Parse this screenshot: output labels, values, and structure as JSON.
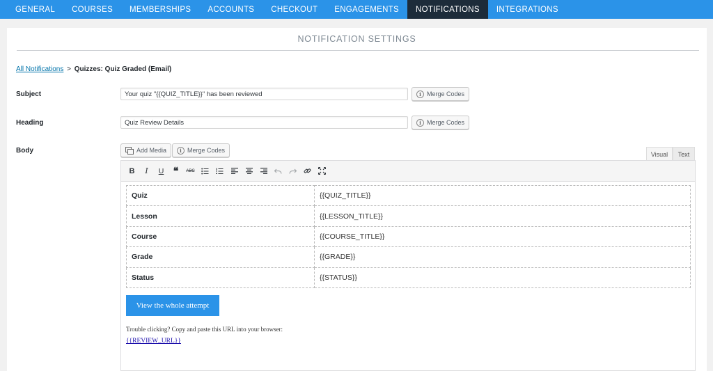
{
  "nav": {
    "tabs": [
      {
        "label": "General"
      },
      {
        "label": "Courses"
      },
      {
        "label": "Memberships"
      },
      {
        "label": "Accounts"
      },
      {
        "label": "Checkout"
      },
      {
        "label": "Engagements"
      },
      {
        "label": "Notifications"
      },
      {
        "label": "Integrations"
      }
    ],
    "active_index": 6
  },
  "panel": {
    "title": "Notification Settings"
  },
  "breadcrumb": {
    "link": "All Notifications",
    "separator": ">",
    "current": "Quizzes: Quiz Graded (Email)"
  },
  "subject": {
    "label": "Subject",
    "value": "Your quiz \"{{QUIZ_TITLE}}\" has been reviewed",
    "merge_label": "Merge Codes"
  },
  "heading": {
    "label": "Heading",
    "value": "Quiz Review Details",
    "merge_label": "Merge Codes"
  },
  "body": {
    "label": "Body",
    "add_media_label": "Add Media",
    "merge_label": "Merge Codes",
    "tab_visual": "Visual",
    "tab_text": "Text",
    "toolbar_icons": [
      "bold-icon",
      "italic-icon",
      "underline-icon",
      "blockquote-icon",
      "strikethrough-icon",
      "bullet-list-icon",
      "numbered-list-icon",
      "align-left-icon",
      "align-center-icon",
      "align-right-icon",
      "undo-icon",
      "redo-icon",
      "link-icon",
      "fullscreen-icon"
    ],
    "toolbar_glyphs": {
      "bold": "B",
      "italic": "I",
      "underline": "U",
      "blockquote": "❝",
      "strikethrough": "ABC"
    },
    "rows": [
      {
        "key": "Quiz",
        "value": "{{QUIZ_TITLE}}"
      },
      {
        "key": "Lesson",
        "value": "{{LESSON_TITLE}}"
      },
      {
        "key": "Course",
        "value": "{{COURSE_TITLE}}"
      },
      {
        "key": "Grade",
        "value": "{{GRADE}}"
      },
      {
        "key": "Status",
        "value": "{{STATUS}}"
      }
    ],
    "cta_label": "View the whole attempt",
    "trouble_text": "Trouble clicking? Copy and paste this URL into your browser:",
    "review_url": "{{REVIEW_URL}}"
  },
  "colors": {
    "nav_bg": "#2b93e8",
    "nav_active_bg": "#1d2c3a",
    "cta_bg": "#2b93e8",
    "link": "#0073aa"
  }
}
